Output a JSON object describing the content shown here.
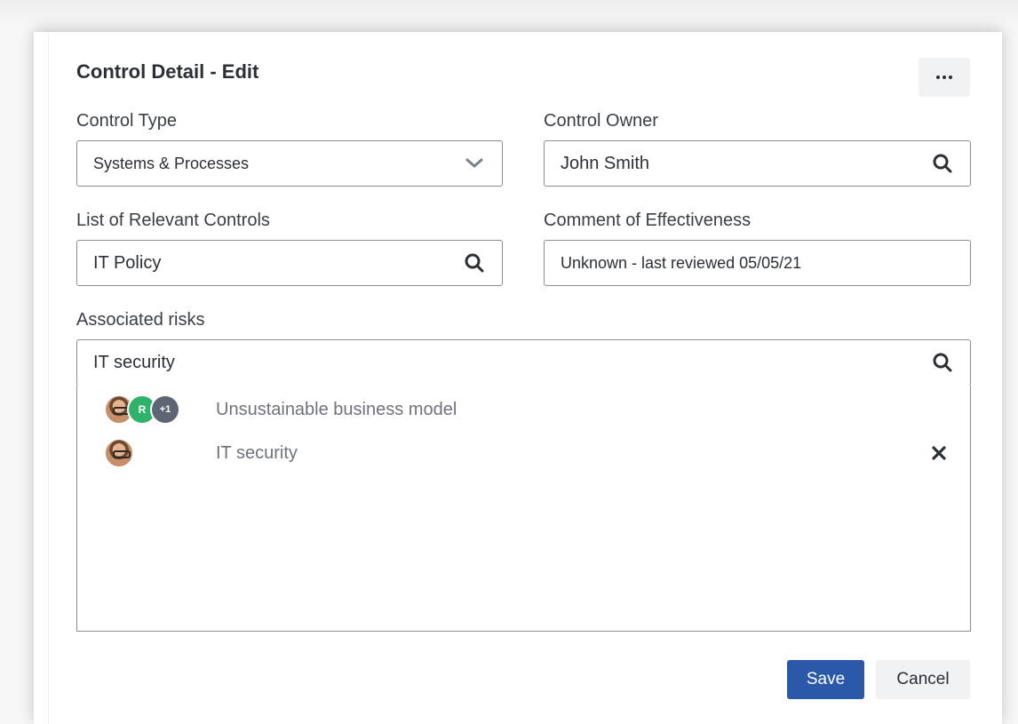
{
  "dialog": {
    "title": "Control Detail - Edit",
    "more_icon": "more-horizontal-icon"
  },
  "fields": {
    "control_type": {
      "label": "Control Type",
      "value": "Systems & Processes",
      "icon": "chevron-down-icon"
    },
    "control_owner": {
      "label": "Control Owner",
      "value": "John Smith",
      "icon": "search-icon"
    },
    "relevant_controls": {
      "label": "List of Relevant Controls",
      "value": "IT Policy",
      "icon": "search-icon"
    },
    "comment_effectiveness": {
      "label": "Comment of Effectiveness",
      "value": "Unknown - last reviewed 05/05/21"
    },
    "associated_risks": {
      "label": "Associated risks",
      "value": "IT security",
      "icon": "search-icon"
    }
  },
  "risks": [
    {
      "name": "Unsustainable business model",
      "avatars": [
        {
          "type": "photo"
        },
        {
          "type": "initial",
          "text": "R"
        },
        {
          "type": "more",
          "text": "+1"
        }
      ]
    },
    {
      "name": "IT security",
      "avatars": [
        {
          "type": "photo"
        }
      ],
      "remove_icon": "close-icon"
    }
  ],
  "actions": {
    "save": "Save",
    "cancel": "Cancel"
  },
  "colors": {
    "primary": "#2b58a8",
    "avatar_green": "#2fb36b",
    "avatar_grey": "#5e6675"
  }
}
